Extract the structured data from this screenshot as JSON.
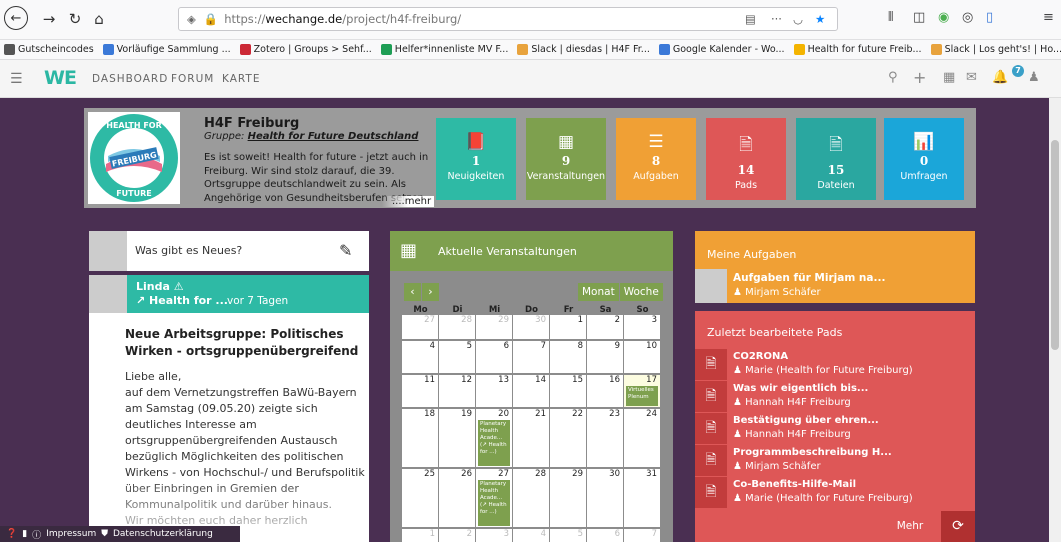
{
  "browser": {
    "url_prefix": "https://",
    "url_domain": "wechange.de",
    "url_path": "/project/h4f-freiburg/",
    "bookmarks": [
      {
        "label": "Gutscheincodes",
        "icon": "x-icon",
        "color": "#555"
      },
      {
        "label": "Vorläufige Sammlung ...",
        "icon": "doc-icon",
        "color": "#3b79d8"
      },
      {
        "label": "Zotero | Groups > Sehf...",
        "icon": "zotero-icon",
        "color": "#cc2936"
      },
      {
        "label": "Helfer*innenliste MV F...",
        "icon": "sheet-icon",
        "color": "#1e9e55"
      },
      {
        "label": "Slack | diesdas | H4F Fr...",
        "icon": "slack-icon",
        "color": "#e8a33d"
      },
      {
        "label": "Google Kalender - Wo...",
        "icon": "calendar-icon",
        "color": "#3b79d8"
      },
      {
        "label": "Health for future Freib...",
        "icon": "drive-icon",
        "color": "#f4b400"
      },
      {
        "label": "Slack | Los geht's! | Ho...",
        "icon": "slack-icon",
        "color": "#e8a33d"
      }
    ]
  },
  "appnav": {
    "logo": "WE",
    "links": [
      "DASHBOARD",
      "FORUM",
      "KARTE"
    ],
    "notification_count": "7"
  },
  "group": {
    "title": "H4F Freiburg",
    "subtitle_prefix": "Gruppe: ",
    "subtitle_link": "Health for Future Deutschland",
    "description": "Es ist soweit! Health for future - jetzt auch in Freiburg. Wir sind stolz darauf, die 39. Ortsgruppe deutschlandweit zu sein. Als Angehörige von Gesundheitsberufen setzen",
    "more": "....mehr",
    "logo_text_top": "HEALTH FOR",
    "logo_text_mid": "FREIBURG",
    "logo_text_bottom": "FUTURE",
    "tiles": [
      {
        "icon": "📕",
        "count": "1",
        "label": "Neuigkeiten",
        "color": "#2ebaa5"
      },
      {
        "icon": "▦",
        "count": "9",
        "label": "Veranstaltungen",
        "color": "#7ea04e"
      },
      {
        "icon": "☰",
        "count": "8",
        "label": "Aufgaben",
        "color": "#f0a035"
      },
      {
        "icon": "🗎",
        "count": "14",
        "label": "Pads",
        "color": "#de5757"
      },
      {
        "icon": "🗎",
        "count": "15",
        "label": "Dateien",
        "color": "#2aa7a0"
      },
      {
        "icon": "📊",
        "count": "0",
        "label": "Umfragen",
        "color": "#1ba6d9"
      }
    ]
  },
  "newpost": {
    "placeholder": "Was gibt es Neues?"
  },
  "post": {
    "author": "Linda",
    "group": "↗ Health for ...",
    "time": "vor 7 Tagen",
    "title": "Neue Arbeitsgruppe: Politisches Wirken - ortsgruppenübergreifend",
    "body": "Liebe alle,\nauf dem Vernetzungstreffen BaWü-Bayern am Samstag (09.05.20) zeigte sich deutliches Interesse am ortsgruppenübergreifenden Austausch bezüglich Möglichkeiten des politischen Wirkens - von Hochschul-/ und Berufspolitik über Einbringen in Gremien der Kommunalpolitik und darüber hinaus.\nWir möchten euch daher herzlich eingeladen, euch zu"
  },
  "footer": {
    "impressum": "Impressum",
    "datenschutz": "Datenschutzerklärung"
  },
  "calendar": {
    "title": "Aktuelle Veranstaltungen",
    "prev": "‹",
    "next": "›",
    "view_month": "Monat",
    "view_week": "Woche",
    "weekdays": [
      "Mo",
      "Di",
      "Mi",
      "Do",
      "Fr",
      "Sa",
      "So"
    ],
    "weeks": [
      [
        {
          "d": "27",
          "dim": true
        },
        {
          "d": "28",
          "dim": true
        },
        {
          "d": "29",
          "dim": true
        },
        {
          "d": "30",
          "dim": true
        },
        {
          "d": "1"
        },
        {
          "d": "2"
        },
        {
          "d": "3"
        }
      ],
      [
        {
          "d": "4"
        },
        {
          "d": "5"
        },
        {
          "d": "6"
        },
        {
          "d": "7"
        },
        {
          "d": "8"
        },
        {
          "d": "9"
        },
        {
          "d": "10"
        }
      ],
      [
        {
          "d": "11"
        },
        {
          "d": "12"
        },
        {
          "d": "13"
        },
        {
          "d": "14"
        },
        {
          "d": "15"
        },
        {
          "d": "16"
        },
        {
          "d": "17",
          "today": true,
          "event": "Virtuelles Plenum"
        }
      ],
      [
        {
          "d": "18"
        },
        {
          "d": "19"
        },
        {
          "d": "20",
          "event": "Planetary Health Acade... (↗ Health for ...)"
        },
        {
          "d": "21"
        },
        {
          "d": "22"
        },
        {
          "d": "23"
        },
        {
          "d": "24"
        }
      ],
      [
        {
          "d": "25"
        },
        {
          "d": "26"
        },
        {
          "d": "27",
          "event": "Planetary Health Acade... (↗ Health for ...)"
        },
        {
          "d": "28"
        },
        {
          "d": "29"
        },
        {
          "d": "30"
        },
        {
          "d": "31"
        }
      ],
      [
        {
          "d": "1",
          "dim": true
        },
        {
          "d": "2",
          "dim": true
        },
        {
          "d": "3",
          "dim": true
        },
        {
          "d": "4",
          "dim": true
        },
        {
          "d": "5",
          "dim": true
        },
        {
          "d": "6",
          "dim": true
        },
        {
          "d": "7",
          "dim": true
        }
      ]
    ]
  },
  "tasks": {
    "title": "Meine Aufgaben",
    "items": [
      {
        "name": "Aufgaben für Mirjam na...",
        "user": "♟ Mirjam Schäfer"
      }
    ]
  },
  "pads": {
    "title": "Zuletzt bearbeitete Pads",
    "items": [
      {
        "name": "CO2RONA",
        "user": "♟ Marie (Health for Future Freiburg)"
      },
      {
        "name": "Was wir eigentlich bis...",
        "user": "♟ Hannah H4F Freiburg"
      },
      {
        "name": "Bestätigung über ehren...",
        "user": "♟ Hannah H4F Freiburg"
      },
      {
        "name": "Programmbeschreibung H...",
        "user": "♟ Mirjam Schäfer"
      },
      {
        "name": "Co-Benefits-Hilfe-Mail",
        "user": "♟ Marie (Health for Future Freiburg)"
      }
    ],
    "more": "Mehr"
  }
}
